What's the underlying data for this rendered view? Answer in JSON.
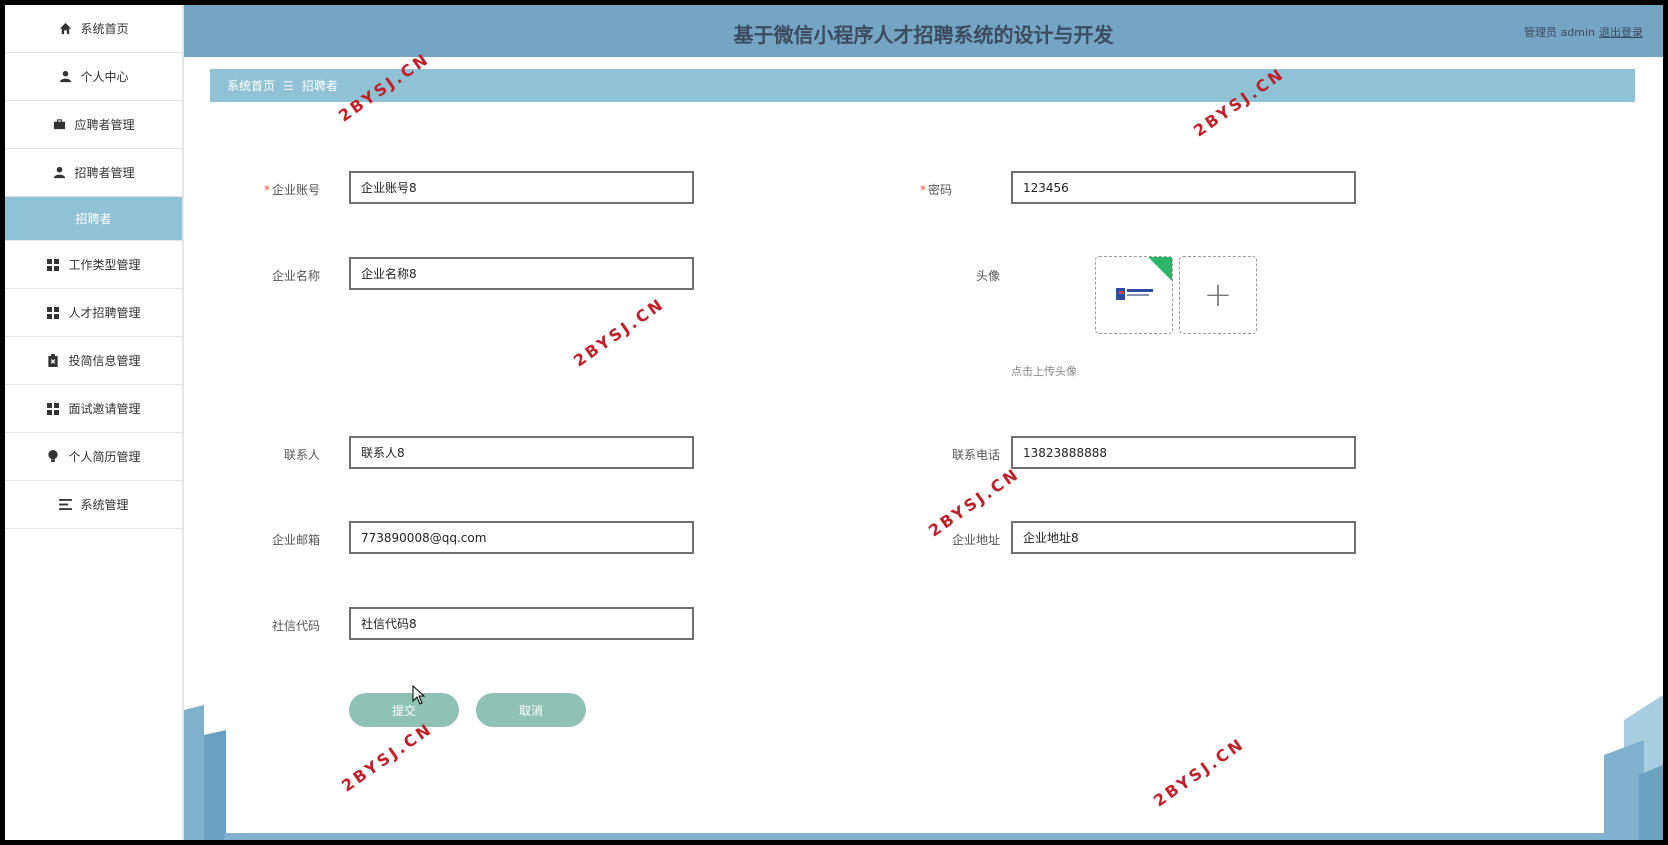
{
  "sidebar": {
    "items": [
      {
        "label": "系统首页",
        "icon": "home-icon"
      },
      {
        "label": "个人中心",
        "icon": "person-icon"
      },
      {
        "label": "应聘者管理",
        "icon": "briefcase-icon"
      },
      {
        "label": "招聘者管理",
        "icon": "person-icon"
      },
      {
        "label": "招聘者",
        "icon": ""
      },
      {
        "label": "工作类型管理",
        "icon": "grid-icon"
      },
      {
        "label": "人才招聘管理",
        "icon": "grid-icon"
      },
      {
        "label": "投简信息管理",
        "icon": "clipboard-icon"
      },
      {
        "label": "面试邀请管理",
        "icon": "grid-icon"
      },
      {
        "label": "个人简历管理",
        "icon": "bulb-icon"
      },
      {
        "label": "系统管理",
        "icon": "menu-icon"
      }
    ]
  },
  "header": {
    "title": "基于微信小程序人才招聘系统的设计与开发",
    "user": "管理员 admin",
    "logout": "退出登录"
  },
  "breadcrumb": {
    "home": "系统首页",
    "separator": "☰",
    "current": "招聘者"
  },
  "form": {
    "account": {
      "label": "企业账号",
      "value": "企业账号8"
    },
    "password": {
      "label": "密码",
      "value": "123456"
    },
    "company_name": {
      "label": "企业名称",
      "value": "企业名称8"
    },
    "avatar": {
      "label": "头像",
      "hint": "点击上传头像",
      "plus": "+"
    },
    "contact": {
      "label": "联系人",
      "value": "联系人8"
    },
    "phone": {
      "label": "联系电话",
      "value": "13823888888"
    },
    "email": {
      "label": "企业邮箱",
      "value": "773890008@qq.com"
    },
    "address": {
      "label": "企业地址",
      "value": "企业地址8"
    },
    "credit_code": {
      "label": "社信代码",
      "value": "社信代码8"
    },
    "required_mark": "*"
  },
  "buttons": {
    "submit": "提交",
    "cancel": "取消"
  },
  "watermark": "2BYSJ.CN",
  "colors": {
    "header": "#74a5c3",
    "breadcrumb": "#90c2d6",
    "button": "#8fc1b5",
    "watermark": "#c0202a"
  }
}
